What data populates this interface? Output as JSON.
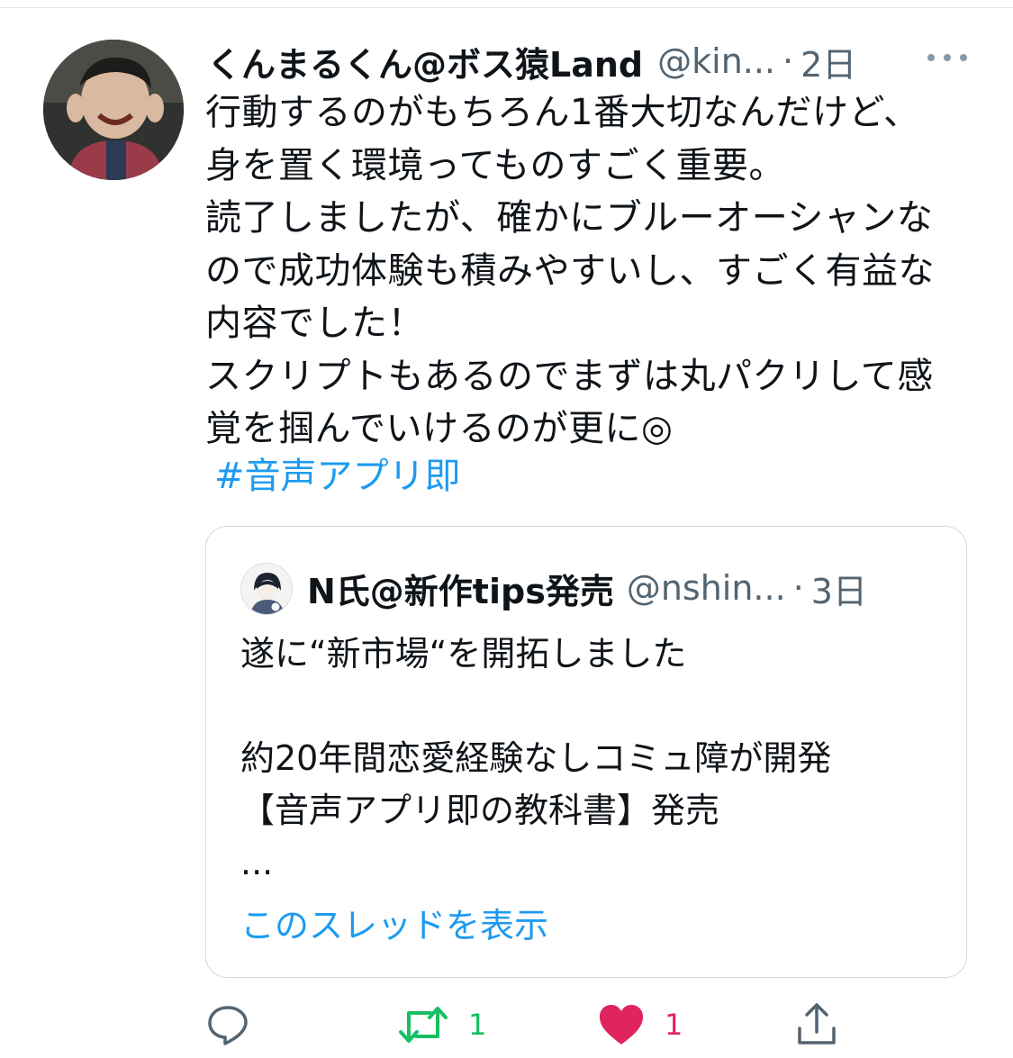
{
  "tweet": {
    "display_name": "くんまるくん@ボス猿Land",
    "handle": "@kin...",
    "separator": "·",
    "time": "2日",
    "body_lines": [
      "行動するのがもちろん1番大切なんだけど、",
      "身を置く環境ってものすごく重要。",
      "読了しましたが、確かにブルーオーシャンな",
      "ので成功体験も積みやすいし、すごく有益な",
      "内容でした！",
      "スクリプトもあるのでまずは丸パクリして感",
      "覚を掴んでいけるのが更に◎"
    ],
    "hashtag": "#音声アプリ即",
    "more_icon": "ellipsis-icon"
  },
  "quoted_tweet": {
    "display_name": "N氏@新作tips発売",
    "handle": "@nshin...",
    "separator": "·",
    "time": "3日",
    "body_lines": [
      "遂に“新市場“を開拓しました",
      "",
      "約20年間恋愛経験なしコミュ障が開発",
      "【音声アプリ即の教科書】発売",
      "..."
    ],
    "show_thread": "このスレッドを表示"
  },
  "actions": {
    "reply": {
      "icon": "reply-icon"
    },
    "retweet": {
      "icon": "retweet-icon",
      "count": "1",
      "color": "#17bf63"
    },
    "like": {
      "icon": "heart-icon",
      "count": "1",
      "color": "#e0245e"
    },
    "share": {
      "icon": "share-icon"
    }
  },
  "colors": {
    "link": "#1d9bf0",
    "secondary_text": "#536471",
    "border": "#cfd9de"
  }
}
